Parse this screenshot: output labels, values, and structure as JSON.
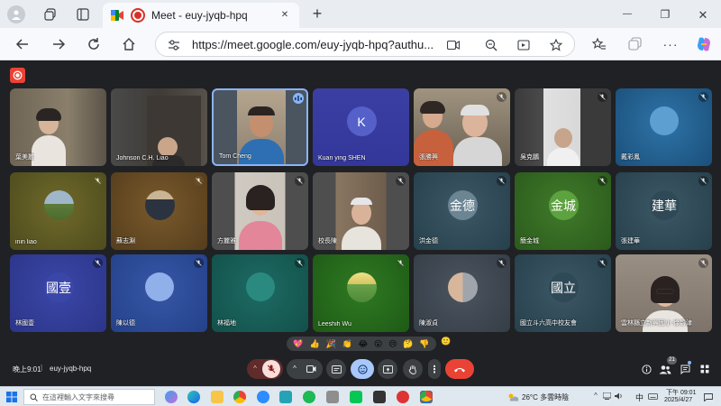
{
  "browser": {
    "tab_title": "Meet - euy-jyqb-hpq",
    "tab_close": "✕",
    "new_tab": "+",
    "url": "https://meet.google.com/euy-jyqb-hpq?authu...",
    "window_controls": {
      "minimize": "—",
      "maximize": "❐",
      "close": "✕"
    }
  },
  "meeting": {
    "time": "晚上9:01",
    "separator": "|",
    "code": "euy-jyqb-hpq",
    "participant_count": "21",
    "reactions": [
      "💖",
      "👍",
      "🎉",
      "👏",
      "😂",
      "😮",
      "😢",
      "🤔",
      "👎",
      "🙂"
    ],
    "participants": [
      {
        "name": "葉美麗"
      },
      {
        "name": "Johnson C.H. Liao"
      },
      {
        "name": "Tom Cheng"
      },
      {
        "name": "Kuan ying SHEN",
        "initial": "K"
      },
      {
        "name": "張勝興"
      },
      {
        "name": "吳克鵬"
      },
      {
        "name": "戴彩鳳"
      },
      {
        "name": "inin liao"
      },
      {
        "name": "蘇志淵"
      },
      {
        "name": "方麗雅"
      },
      {
        "name": "校長陳"
      },
      {
        "name": "洪金德",
        "initial": "金德"
      },
      {
        "name": "簡金城",
        "initial": "金城"
      },
      {
        "name": "張建華",
        "initial": "建華"
      },
      {
        "name": "林國壹",
        "initial": "國壹"
      },
      {
        "name": "陳以德"
      },
      {
        "name": "林福地"
      },
      {
        "name": "Leeshih Wu"
      },
      {
        "name": "陳淑貞"
      },
      {
        "name": "國立斗六高中校友會",
        "initial": "國立"
      },
      {
        "name": "雲林縣立新興國小 徐碧津"
      }
    ]
  },
  "taskbar": {
    "search_placeholder": "在這裡輸入文字來搜尋",
    "weather": "26°C 多雲時陰",
    "ime": "中",
    "time": "下午 09:01",
    "date": "2025/4/27"
  },
  "colors": {
    "accent_blue": "#8ab4f8",
    "end_call_red": "#ea4335",
    "record_red": "#ea4335"
  }
}
